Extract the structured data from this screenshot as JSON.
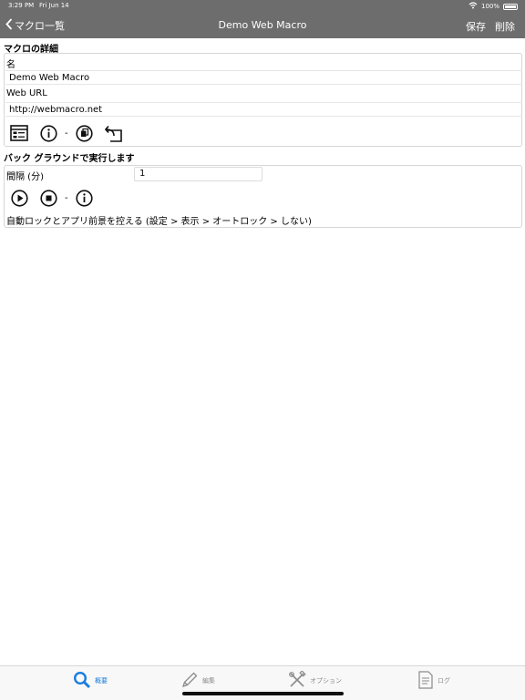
{
  "status": {
    "time": "3:29 PM",
    "date": "Fri Jun 14",
    "battery": "100%"
  },
  "nav": {
    "back_label": "マクロ一覧",
    "title": "Demo Web Macro",
    "save_label": "保存",
    "delete_label": "削除"
  },
  "details": {
    "section_title": "マクロの詳細",
    "name_label": "名",
    "name_value": "Demo Web Macro",
    "url_label": "Web URL",
    "url_value": "http://webmacro.net",
    "icons": [
      "browser-form-icon",
      "info-icon",
      "copy-icon",
      "share-icon"
    ]
  },
  "background": {
    "section_title": "バック グラウンドで実行します",
    "interval_label": "間隔 (分)",
    "interval_value": "1",
    "icons": [
      "play-icon",
      "stop-icon",
      "info-icon"
    ],
    "note": "自動ロックとアプリ前景を控える (設定 > 表示 > オートロック > しない)"
  },
  "tabs": [
    {
      "label": "概要",
      "icon": "search-icon",
      "active": true
    },
    {
      "label": "編集",
      "icon": "pencil-icon",
      "active": false
    },
    {
      "label": "オプション",
      "icon": "tools-icon",
      "active": false
    },
    {
      "label": "ログ",
      "icon": "document-icon",
      "active": false
    }
  ],
  "colors": {
    "nav_bg": "#6d6d6d",
    "accent": "#1a7ee0",
    "tab_inactive": "#8a8a8a"
  }
}
